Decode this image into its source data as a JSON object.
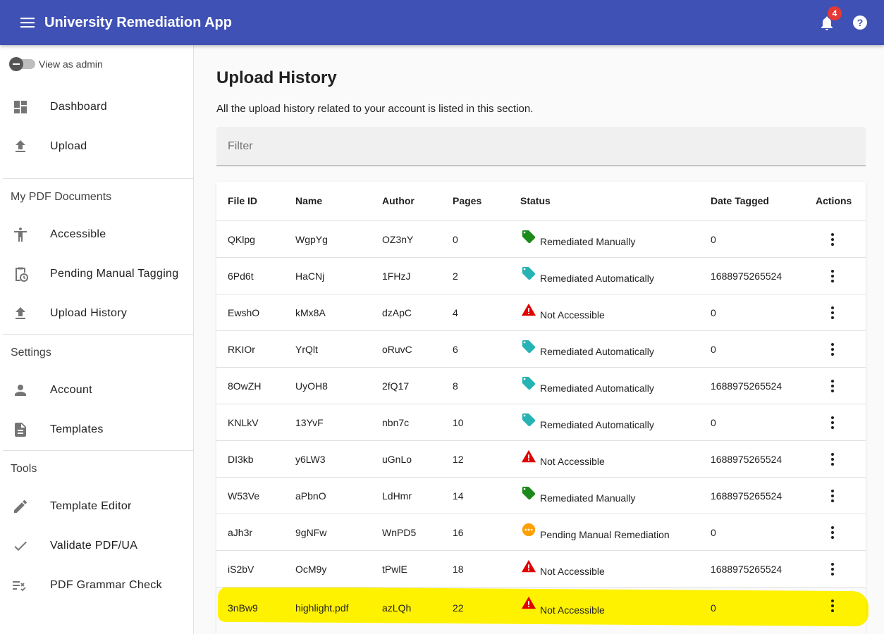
{
  "appbar": {
    "title": "University Remediation App",
    "notification_count": "4",
    "color": "#3f51b5"
  },
  "sidebar": {
    "view_as_admin": "View as admin",
    "top_items": [
      {
        "label": "Dashboard",
        "icon": "dashboard-icon"
      },
      {
        "label": "Upload",
        "icon": "upload-icon"
      }
    ],
    "sections": [
      {
        "header": "My PDF Documents",
        "items": [
          {
            "label": "Accessible",
            "icon": "accessibility-icon"
          },
          {
            "label": "Pending Manual Tagging",
            "icon": "pending-clipboard-icon"
          },
          {
            "label": "Upload History",
            "icon": "upload-icon"
          }
        ]
      },
      {
        "header": "Settings",
        "items": [
          {
            "label": "Account",
            "icon": "person-icon"
          },
          {
            "label": "Templates",
            "icon": "document-icon"
          }
        ]
      },
      {
        "header": "Tools",
        "items": [
          {
            "label": "Template Editor",
            "icon": "pencil-icon"
          },
          {
            "label": "Validate PDF/UA",
            "icon": "check-icon"
          },
          {
            "label": "PDF Grammar Check",
            "icon": "spellcheck-icon"
          }
        ]
      }
    ]
  },
  "main": {
    "title": "Upload History",
    "description": "All the upload history related to your account is listed in this section.",
    "filter_placeholder": "Filter"
  },
  "table": {
    "columns": [
      "File ID",
      "Name",
      "Author",
      "Pages",
      "Status",
      "Date Tagged",
      "Actions"
    ],
    "rows": [
      {
        "file_id": "QKlpg",
        "name": "WgpYg",
        "author": "OZ3nY",
        "pages": "0",
        "status": "Remediated Manually",
        "status_icon": "green-tag-icon",
        "date": "0"
      },
      {
        "file_id": "6Pd6t",
        "name": "HaCNj",
        "author": "1FHzJ",
        "pages": "2",
        "status": "Remediated Automatically",
        "status_icon": "teal-tag-icon",
        "date": "1688975265524"
      },
      {
        "file_id": "EwshO",
        "name": "kMx8A",
        "author": "dzApC",
        "pages": "4",
        "status": "Not Accessible",
        "status_icon": "warning-icon",
        "date": "0"
      },
      {
        "file_id": "RKIOr",
        "name": "YrQlt",
        "author": "oRuvC",
        "pages": "6",
        "status": "Remediated Automatically",
        "status_icon": "teal-tag-icon",
        "date": "0"
      },
      {
        "file_id": "8OwZH",
        "name": "UyOH8",
        "author": "2fQ17",
        "pages": "8",
        "status": "Remediated Automatically",
        "status_icon": "teal-tag-icon",
        "date": "1688975265524"
      },
      {
        "file_id": "KNLkV",
        "name": "13YvF",
        "author": "nbn7c",
        "pages": "10",
        "status": "Remediated Automatically",
        "status_icon": "teal-tag-icon",
        "date": "0"
      },
      {
        "file_id": "DI3kb",
        "name": "y6LW3",
        "author": "uGnLo",
        "pages": "12",
        "status": "Not Accessible",
        "status_icon": "warning-icon",
        "date": "1688975265524"
      },
      {
        "file_id": "W53Ve",
        "name": "aPbnO",
        "author": "LdHmr",
        "pages": "14",
        "status": "Remediated Manually",
        "status_icon": "green-tag-icon",
        "date": "1688975265524"
      },
      {
        "file_id": "aJh3r",
        "name": "9gNFw",
        "author": "WnPD5",
        "pages": "16",
        "status": "Pending Manual Remediation",
        "status_icon": "pending-icon",
        "date": "0"
      },
      {
        "file_id": "iS2bV",
        "name": "OcM9y",
        "author": "tPwlE",
        "pages": "18",
        "status": "Not Accessible",
        "status_icon": "warning-icon",
        "date": "1688975265524"
      },
      {
        "file_id": "3nBw9",
        "name": "highlight.pdf",
        "author": "azLQh",
        "pages": "22",
        "status": "Not Accessible",
        "status_icon": "warning-icon",
        "date": "0",
        "highlighted": true
      }
    ]
  },
  "colors": {
    "primary": "#3f51b5",
    "badge": "#e53935",
    "tag_green": "#1b8a1b",
    "tag_teal": "#26b3b3",
    "warning_red": "#e00000",
    "pending_orange": "#ffa000",
    "highlight": "#fff200"
  }
}
